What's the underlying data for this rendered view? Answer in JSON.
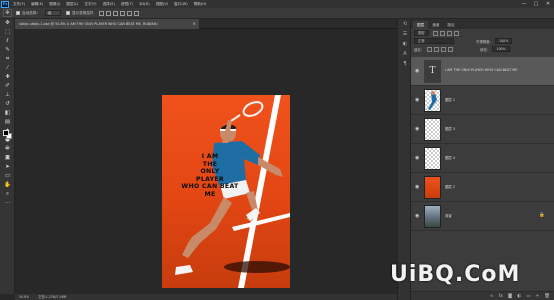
{
  "app": {
    "logo": "Ps"
  },
  "menubar": {
    "items": [
      "文件(F)",
      "编辑(E)",
      "图像(I)",
      "图层(L)",
      "文字(Y)",
      "选择(S)",
      "滤镜(T)",
      "3D(D)",
      "视图(V)",
      "窗口(W)",
      "帮助(H)"
    ],
    "min": "—",
    "max": "□",
    "close": "✕"
  },
  "options": {
    "auto_select_label": "自动选择：",
    "group_value": "组",
    "show_transform_label": "显示变换控件"
  },
  "document": {
    "tab_title": "ubbjx-ubbjx-1.psd @ 50.8% (I AM THE ONLY PLAYER WHO CAN BEAT ME, RGB/8#)",
    "close": "×"
  },
  "poster": {
    "text_lines": [
      "I AM",
      "THE",
      "ONLY",
      "PLAYER",
      "WHO CAN BEAT",
      "ME"
    ]
  },
  "status": {
    "zoom": "50.8%",
    "doc_info": "文档:1.23M/7.46M"
  },
  "panel": {
    "tabs": [
      "图层",
      "通道",
      "路径"
    ],
    "kind_label": "类型",
    "blend_mode": "正常",
    "opacity_label": "不透明度：",
    "opacity_value": "100%",
    "lock_label": "锁定：",
    "fill_label": "填充：",
    "fill_value": "100%"
  },
  "layers": [
    {
      "name": "I AM THE ONLY PLAYER WHO CAN BEAT ME",
      "thumb": "T",
      "selected": true
    },
    {
      "name": "图层 1",
      "selected": false
    },
    {
      "name": "图层 3",
      "selected": false
    },
    {
      "name": "图层 4",
      "selected": false
    },
    {
      "name": "图层 2",
      "selected": false
    },
    {
      "name": "背景",
      "selected": false
    }
  ],
  "watermark": {
    "text": "UiBQ.CoM"
  },
  "colors": {
    "canvas_top": "#f1521c",
    "canvas_bottom": "#c73c0d",
    "ui_dark": "#282828",
    "panel": "#3c3c3c"
  }
}
